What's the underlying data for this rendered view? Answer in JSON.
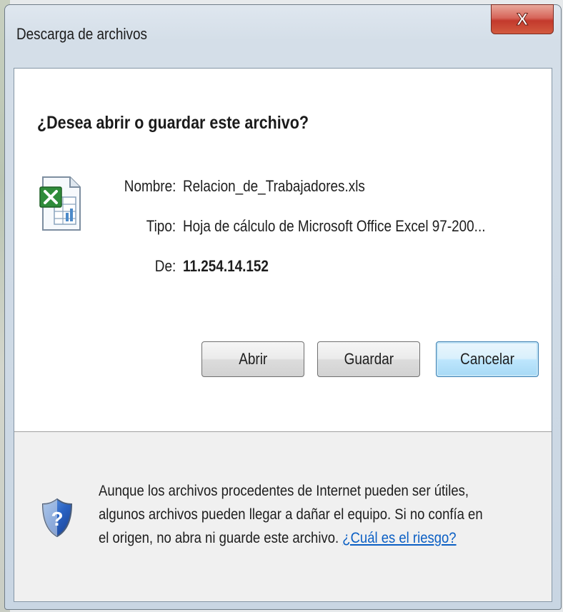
{
  "window": {
    "title": "Descarga de archivos",
    "close_label": "X"
  },
  "dialog": {
    "question": "¿Desea abrir o guardar este archivo?",
    "file_icon": "excel-file-icon",
    "fields": {
      "name_label": "Nombre:",
      "name_value": "Relacion_de_Trabajadores.xls",
      "type_label": "Tipo:",
      "type_value": "Hoja de cálculo de Microsoft Office Excel 97-200...",
      "from_label": "De:",
      "from_value": "11.254.14.152"
    },
    "buttons": {
      "open": "Abrir",
      "save": "Guardar",
      "cancel": "Cancelar"
    }
  },
  "footer": {
    "icon": "shield-question-icon",
    "warning_line1": "Aunque los archivos procedentes de Internet pueden ser útiles,",
    "warning_line2": "algunos archivos pueden llegar a dañar el equipo. Si no confía en",
    "warning_line3_prefix": "el origen, no abra ni guarde este archivo.",
    "risk_link": "¿Cuál es el riesgo?"
  },
  "colors": {
    "link": "#0b5fc4",
    "close_button": "#c3392c",
    "default_button_border": "#3c7fb1"
  }
}
